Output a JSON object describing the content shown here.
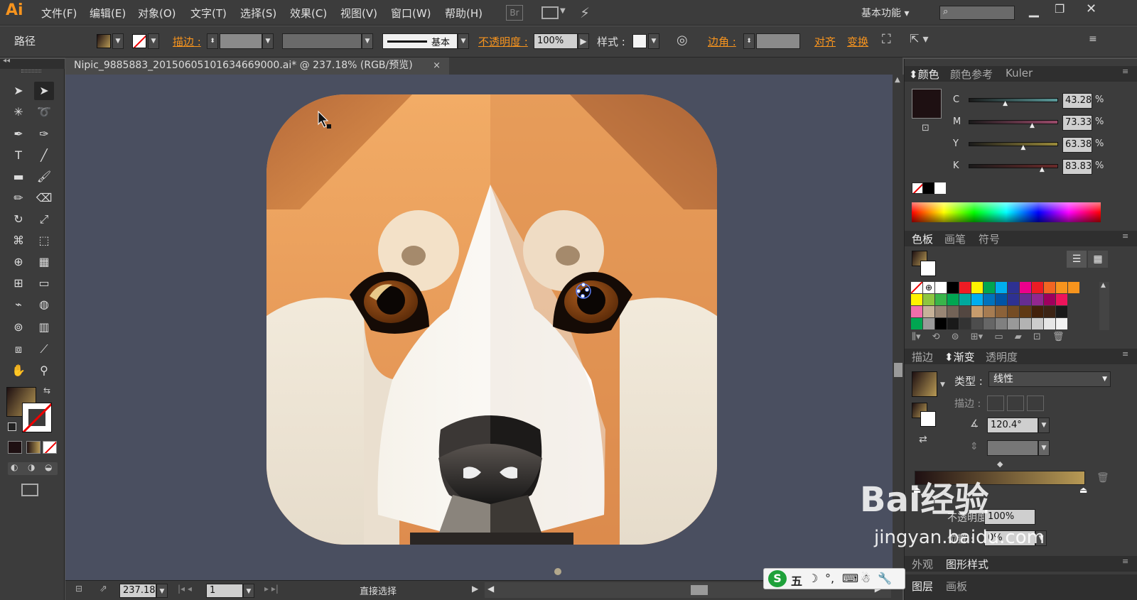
{
  "app": {
    "logo": "Ai",
    "workspace": "基本功能",
    "search_placeholder": ""
  },
  "menu": [
    "文件(F)",
    "编辑(E)",
    "对象(O)",
    "文字(T)",
    "选择(S)",
    "效果(C)",
    "视图(V)",
    "窗口(W)",
    "帮助(H)"
  ],
  "menu_extra": {
    "br": "Br"
  },
  "control": {
    "selection_type": "路径",
    "stroke_label": "描边 :",
    "stroke_profile": "基本",
    "opacity_label": "不透明度 :",
    "opacity_value": "100%",
    "style_label": "样式 :",
    "corner_label": "边角 :",
    "align_label": "对齐",
    "transform_label": "变换"
  },
  "document": {
    "tab_title": "Nipic_9885883_20150605101634669000.ai* @ 237.18% (RGB/预览)",
    "close": "×"
  },
  "status": {
    "zoom": "237.18",
    "artboard": "1",
    "tool_name": "直接选择"
  },
  "color_panel": {
    "tabs": [
      "颜色",
      "颜色参考",
      "Kuler"
    ],
    "channels": [
      {
        "name": "C",
        "value": "43.28",
        "pct": 0.43,
        "track": "#5a9a9a"
      },
      {
        "name": "M",
        "value": "73.33",
        "pct": 0.73,
        "track": "#9a4a6a"
      },
      {
        "name": "Y",
        "value": "63.38",
        "pct": 0.63,
        "track": "#9a8a3a"
      },
      {
        "name": "K",
        "value": "83.83",
        "pct": 0.84,
        "track": "#6a2a2a"
      }
    ],
    "unit": "%",
    "current_color": "#1e1012"
  },
  "swatches_panel": {
    "tabs": [
      "色板",
      "画笔",
      "符号"
    ],
    "rows": [
      [
        "none",
        "reg",
        "#ffffff",
        "#000000",
        "#ee1c24",
        "#fff200",
        "#00a651",
        "#00aeef",
        "#2e3192",
        "#ec008c",
        "#ed1c24",
        "#f26522",
        "#f7941d",
        "#f7941d"
      ],
      [
        "#fff200",
        "#8dc63f",
        "#39b54a",
        "#00a651",
        "#00a99d",
        "#00aeef",
        "#0072bc",
        "#0054a6",
        "#2e3192",
        "#662d91",
        "#92278f",
        "#9e005d",
        "#ed145b"
      ],
      [
        "#f06eaa",
        "#c7b299",
        "#998675",
        "#736357",
        "#534741",
        "#c69c6d",
        "#a67c52",
        "#8c6239",
        "#754c24",
        "#603913",
        "#42210b",
        "#3c2415",
        "#1a1a1a"
      ],
      [
        "#00a651",
        "#999999",
        "#000000",
        "#1a1a1a",
        "#333333",
        "#4d4d4d",
        "#666666",
        "#808080",
        "#999999",
        "#b3b3b3",
        "#cccccc",
        "#e6e6e6",
        "#f2f2f2"
      ]
    ]
  },
  "gradient_panel": {
    "tabs": [
      "描边",
      "渐变",
      "透明度"
    ],
    "type_label": "类型 :",
    "type_value": "线性",
    "stroke_label": "描边 :",
    "angle": "120.4°",
    "opacity_label": "不透明度 :",
    "opacity_value": "100%",
    "position_label": "位置 :",
    "position_value": "0%"
  },
  "bottom_panels": {
    "appearance_tabs": [
      "外观",
      "图形样式"
    ],
    "layer_tabs": [
      "图层",
      "画板"
    ]
  },
  "overlay": {
    "ime_text": "五",
    "watermark": "Bai经验",
    "watermark_url": "jingyan.baidu.com"
  },
  "colors": {
    "accent": "#f7941e",
    "canvas_bg": "#4a4f60",
    "ui_bg": "#3c3c3c"
  }
}
